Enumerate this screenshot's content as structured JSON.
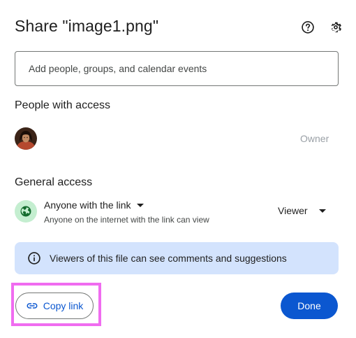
{
  "dialog": {
    "title": "Share \"image1.png\"",
    "help_icon": "help-circle-icon",
    "settings_icon": "gear-icon"
  },
  "add_people": {
    "placeholder": "Add people, groups, and calendar events",
    "value": ""
  },
  "people_with_access": {
    "heading": "People with access",
    "people": [
      {
        "avatar": "user-avatar",
        "role": "Owner"
      }
    ]
  },
  "general_access": {
    "heading": "General access",
    "icon": "globe-icon",
    "scope": "Anyone with the link",
    "description": "Anyone on the internet with the link can view",
    "role": "Viewer"
  },
  "info_banner": {
    "icon": "info-icon",
    "text": "Viewers of this file can see comments and suggestions"
  },
  "footer": {
    "copy_link_label": "Copy link",
    "copy_link_icon": "link-icon",
    "done_label": "Done"
  },
  "colors": {
    "primary": "#0b57d0",
    "banner_bg": "#d3e3fd",
    "globe_bg": "#c4eed0",
    "highlight": "#f06cf0"
  }
}
